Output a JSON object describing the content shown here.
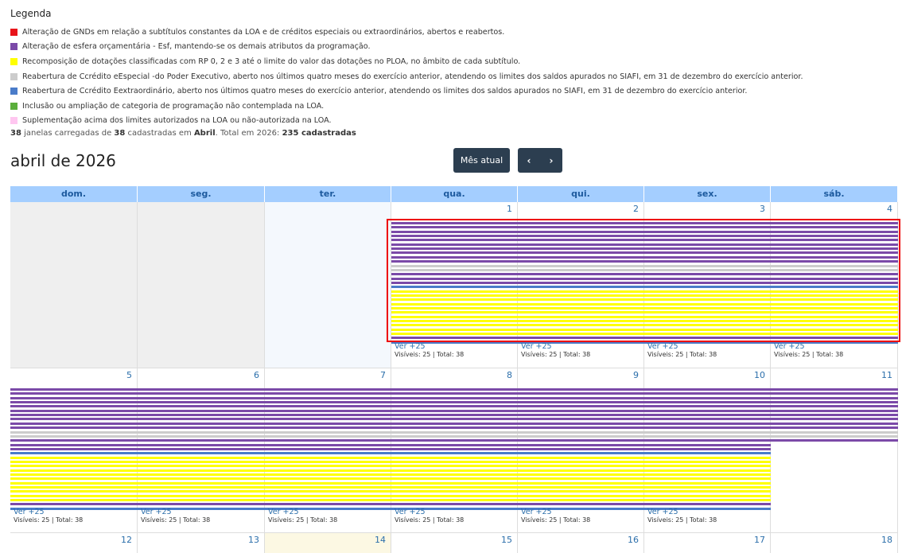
{
  "legend": {
    "title": "Legenda",
    "items": [
      {
        "color": "#e8141a",
        "label": "Alteração de GNDs em relação a subtítulos constantes da LOA e de créditos especiais ou extraordinários, abertos e reabertos."
      },
      {
        "color": "#7b4aa8",
        "label": "Alteração de esfera orçamentária - Esf, mantendo-se os demais atributos da programação."
      },
      {
        "color": "#ffff00",
        "label": "Recomposição de dotações classificadas com RP 0, 2 e 3 até o limite do valor das dotações no PLOA, no âmbito de cada subtítulo."
      },
      {
        "color": "#cccccc",
        "label": "Reabertura de Ccrédito eEspecial -do Poder Executivo, aberto nos últimos quatro meses do exercício anterior, atendendo os limites dos saldos apurados no SIAFI, em 31 de dezembro do exercício anterior."
      },
      {
        "color": "#4a7cc9",
        "label": "Reabertura de Ccrédito Eextraordinário, aberto nos últimos quatro meses do exercício anterior, atendendo os limites dos saldos apurados no SIAFI, em 31 de dezembro do exercício anterior."
      },
      {
        "color": "#5aae3c",
        "label": "Inclusão ou ampliação de categoria de programação não contemplada na LOA."
      },
      {
        "color": "#ffc6f0",
        "label": "Suplementação acima dos limites autorizados na LOA ou não-autorizada na LOA."
      }
    ]
  },
  "summary": {
    "loaded": "38",
    "t1": " janelas carregadas de ",
    "registered": "38",
    "t2": " cadastradas em ",
    "month": "Abril",
    "t3": ". Total em 2026: ",
    "year_total": "235 cadastradas"
  },
  "calendar": {
    "title": "abril de 2026",
    "today_button": "Mês atual",
    "prev_icon": "‹",
    "next_icon": "›",
    "weekdays": [
      "dom.",
      "seg.",
      "ter.",
      "qua.",
      "qui.",
      "sex.",
      "sáb."
    ],
    "weeks": [
      [
        "",
        "",
        "",
        "1",
        "2",
        "3",
        "4"
      ],
      [
        "5",
        "6",
        "7",
        "8",
        "9",
        "10",
        "11"
      ],
      [
        "12",
        "13",
        "14",
        "15",
        "16",
        "17",
        "18"
      ]
    ],
    "more_label": "Ver +25",
    "more_sub": "Visíveis: 25 | Total: 38",
    "event_colors": {
      "purple": "#7b4aa8",
      "gray": "#cccccc",
      "blue": "#4a7cc9",
      "yellow": "#ffff00"
    }
  }
}
